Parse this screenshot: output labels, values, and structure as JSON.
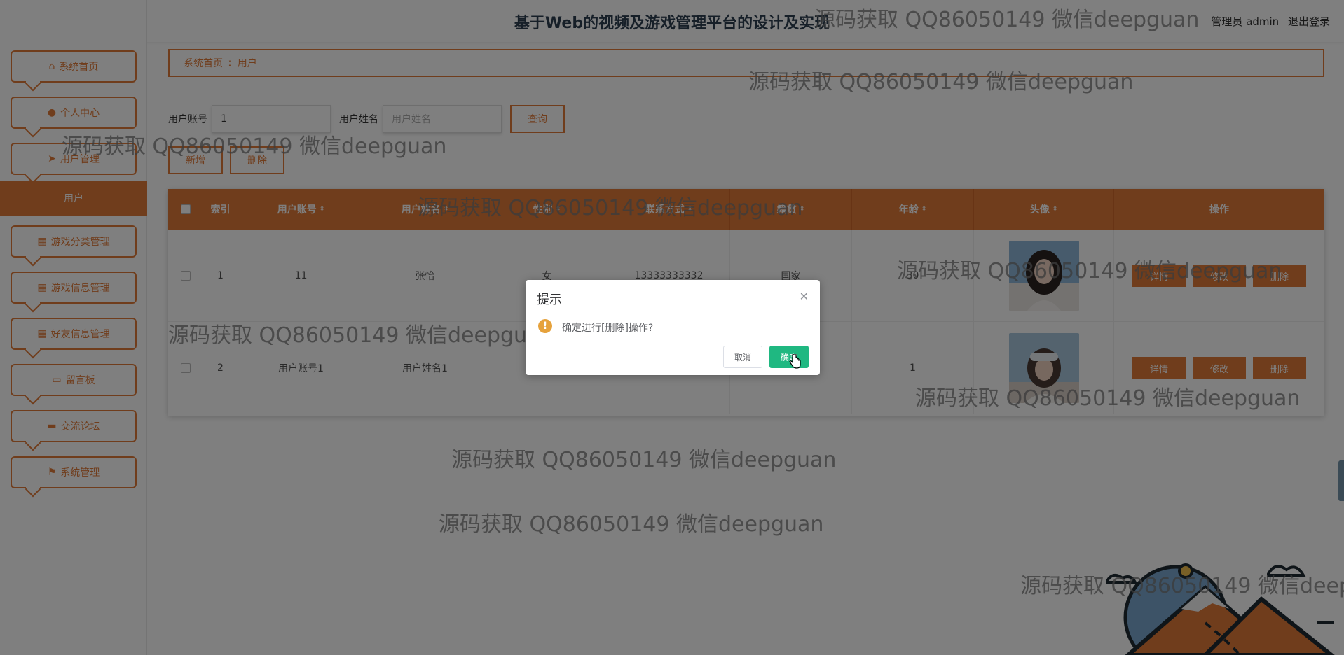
{
  "header": {
    "title": "基于Web的视频及游戏管理平台的设计及实现",
    "user": "管理员 admin",
    "logout": "退出登录"
  },
  "sidebar": {
    "items": [
      {
        "label": "系统首页",
        "icon": "home-icon"
      },
      {
        "label": "个人中心",
        "icon": "user-icon"
      },
      {
        "label": "用户管理",
        "icon": "send-icon"
      },
      {
        "label": "游戏分类管理",
        "icon": "grid-icon"
      },
      {
        "label": "游戏信息管理",
        "icon": "grid-icon"
      },
      {
        "label": "好友信息管理",
        "icon": "grid-icon"
      },
      {
        "label": "留言板",
        "icon": "monitor-icon"
      },
      {
        "label": "交流论坛",
        "icon": "message-icon"
      },
      {
        "label": "系统管理",
        "icon": "flag-icon"
      }
    ],
    "active_sub": "用户"
  },
  "breadcrumb": {
    "home": "系统首页",
    "sep": "ː",
    "current": "用户"
  },
  "search": {
    "account_label": "用户账号",
    "account_value": "1",
    "name_label": "用户姓名",
    "name_placeholder": "用户姓名",
    "query_button": "查询"
  },
  "actions": {
    "add": "新增",
    "delete": "删除"
  },
  "table": {
    "columns": [
      "索引",
      "用户账号",
      "用户姓名",
      "性别",
      "联系方式",
      "籍贯",
      "年龄",
      "头像",
      "操作"
    ],
    "rows": [
      {
        "index": "1",
        "account": "11",
        "name": "张怡",
        "gender": "女",
        "phone": "13333333332",
        "hometown": "国家",
        "age": "30"
      },
      {
        "index": "2",
        "account": "用户账号1",
        "name": "用户姓名1",
        "gender": "",
        "phone": "",
        "hometown": "",
        "age": "1"
      }
    ],
    "op_detail": "详情",
    "op_edit": "修改",
    "op_delete": "删除"
  },
  "dialog": {
    "title": "提示",
    "message": "确定进行[删除]操作?",
    "cancel": "取消",
    "confirm": "确定"
  },
  "watermark": "源码获取 QQ86050149 微信deepguan",
  "colors": {
    "accent": "#e07b39",
    "confirm": "#1fb881",
    "warning": "#e6a23c"
  }
}
